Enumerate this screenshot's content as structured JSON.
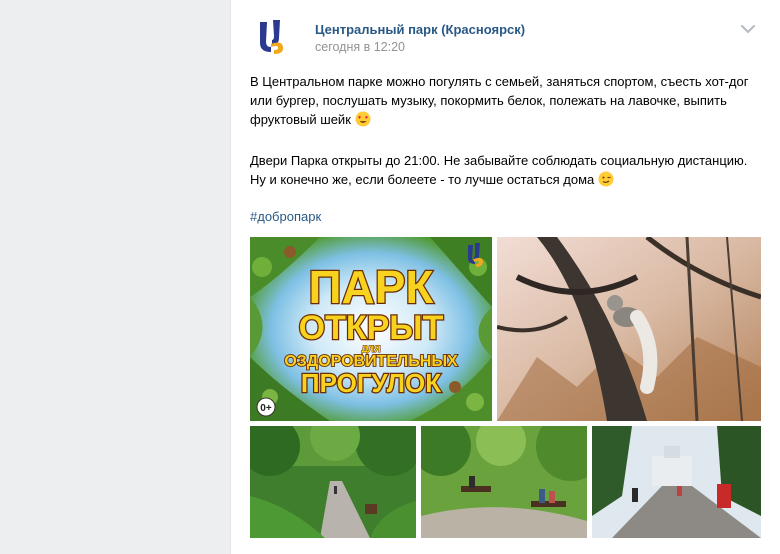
{
  "post": {
    "author": "Центральный парк (Красноярск)",
    "time": "сегодня в 12:20",
    "text_p1": "В Центральном парке можно погулять с семьей, заняться спортом, съесть хот-дог или бургер, послушать музыку, покормить белок, полежать на лавочке, выпить фруктовый шейк",
    "text_p2": "Двери Парка открыты до 21:00. Не забывайте соблюдать социальную дистанцию. Ну и конечно же, если болеете - то лучше остаться дома",
    "hashtag": "#добропарк",
    "emoji_1": "heart-eyes-emoji",
    "emoji_2": "winking-face-emoji"
  },
  "poster": {
    "line1": "ПАРК",
    "line2": "ОТКРЫТ",
    "line3": "ДЛЯ",
    "line4": "ОЗДОРОВИТЕЛЬНЫХ",
    "line5": "ПРОГУЛОК",
    "age_rating": "0+"
  },
  "colors": {
    "link": "#2a5885",
    "page_bg": "#edeef0",
    "muted": "#939393",
    "poster_text": "#f7d21e"
  }
}
